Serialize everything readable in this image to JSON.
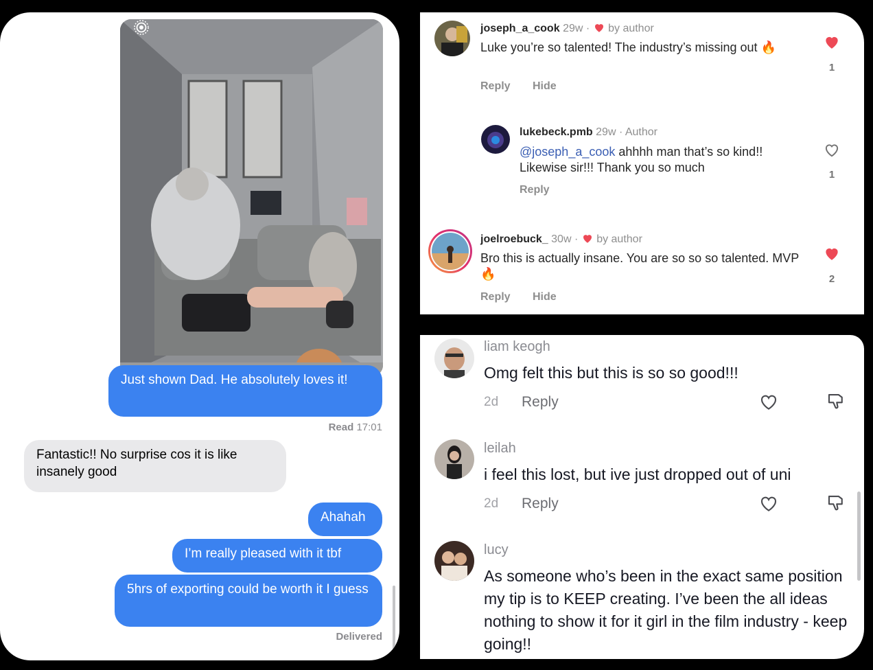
{
  "messages": {
    "out1": "Just shown Dad. He absolutely loves it!",
    "read_label": "Read",
    "read_time": "17:01",
    "in1": "Fantastic!! No surprise cos it is like insanely good",
    "out2": "Ahahah",
    "out3": "I’m really pleased with it tbf",
    "out4": "5hrs of exporting could be worth it I guess",
    "delivered": "Delivered"
  },
  "instagram": {
    "accent_like": "#ed4956",
    "mention_color": "#3a5eb3",
    "comments": [
      {
        "user": "joseph_a_cook",
        "time": "29w ·",
        "badge": "by author",
        "text": "Luke you’re so talented! The industry’s missing out 🔥",
        "reply": "Reply",
        "hide": "Hide",
        "likes": "1",
        "liked": true
      },
      {
        "user": "lukebeck.pmb",
        "time": "29w ·",
        "badge": "Author",
        "mention": "@joseph_a_cook",
        "text": "ahhhh man that’s so kind!! Likewise sir!!! Thank you so much",
        "reply": "Reply",
        "likes": "1",
        "liked": false
      },
      {
        "user": "joelroebuck_",
        "time": "30w ·",
        "badge": "by author",
        "text": "Bro this is actually insane. You are so so so talented. MVP 🔥",
        "reply": "Reply",
        "hide": "Hide",
        "likes": "2",
        "liked": true
      }
    ]
  },
  "tiktok": {
    "comments": [
      {
        "user": "liam keogh",
        "text": "Omg felt this but this is so so good!!!",
        "time": "2d",
        "reply": "Reply"
      },
      {
        "user": "leilah",
        "text": "i feel this lost, but ive just dropped out of uni",
        "time": "2d",
        "reply": "Reply"
      },
      {
        "user": "lucy",
        "text": "As someone who’s been in the exact same position my tip is to KEEP creating. I’ve been the all ideas nothing to show it for it girl in the film industry - keep going!!"
      }
    ]
  },
  "icons": {
    "live_photo": "live-photo-icon",
    "like": "heart-icon",
    "dislike": "thumbs-down-icon"
  }
}
